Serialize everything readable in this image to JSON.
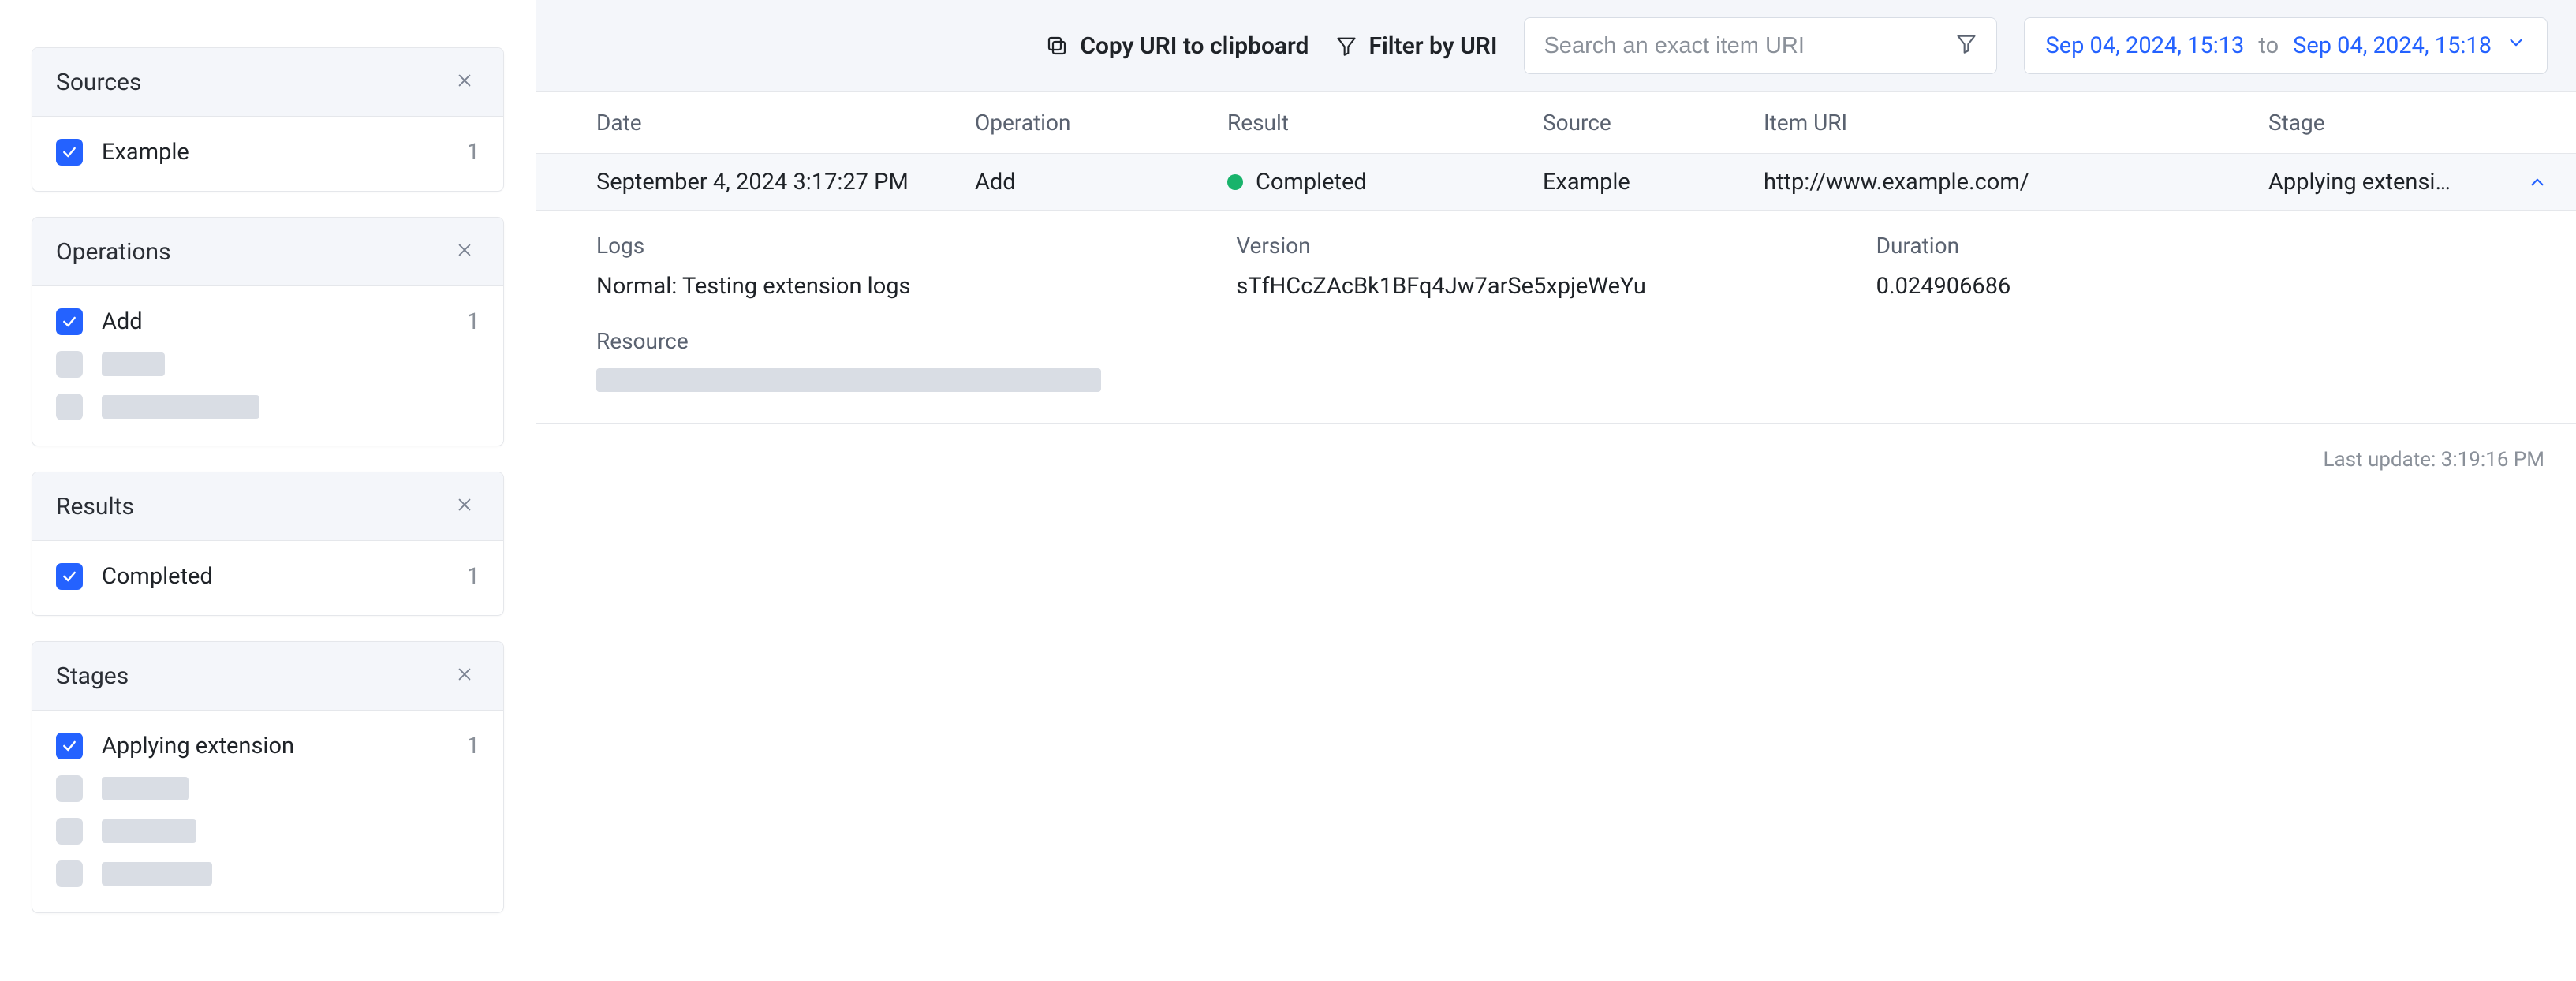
{
  "sidebar": {
    "filters": [
      {
        "key": "sources",
        "title": "Sources",
        "items": [
          {
            "label": "Example",
            "count": "1",
            "checked": true
          }
        ]
      },
      {
        "key": "operations",
        "title": "Operations",
        "items": [
          {
            "label": "Add",
            "count": "1",
            "checked": true
          }
        ],
        "skeletons": 2,
        "skeleton_widths": [
          80,
          200
        ]
      },
      {
        "key": "results",
        "title": "Results",
        "items": [
          {
            "label": "Completed",
            "count": "1",
            "checked": true
          }
        ]
      },
      {
        "key": "stages",
        "title": "Stages",
        "items": [
          {
            "label": "Applying extension",
            "count": "1",
            "checked": true
          }
        ],
        "skeletons": 3,
        "skeleton_widths": [
          110,
          120,
          140
        ]
      }
    ]
  },
  "toolbar": {
    "copy_uri_label": "Copy URI to clipboard",
    "filter_uri_label": "Filter by URI",
    "search_placeholder": "Search an exact item URI",
    "date_range": {
      "from": "Sep 04, 2024, 15:13",
      "sep": "to",
      "to": "Sep 04, 2024, 15:18"
    }
  },
  "table": {
    "columns": {
      "date": "Date",
      "operation": "Operation",
      "result": "Result",
      "source": "Source",
      "item_uri": "Item URI",
      "stage": "Stage"
    },
    "row": {
      "date": "September 4, 2024 3:17:27 PM",
      "operation": "Add",
      "result": "Completed",
      "source": "Example",
      "item_uri": "http://www.example.com/",
      "stage": "Applying extension",
      "status_color": "#18b36b"
    },
    "details": {
      "logs_label": "Logs",
      "version_label": "Version",
      "duration_label": "Duration",
      "logs_value": "Normal: Testing extension logs",
      "version_value": "sTfHCcZAcBk1BFq4Jw7arSe5xpjeWeYu",
      "duration_value": "0.024906686",
      "resource_label": "Resource"
    }
  },
  "footer": {
    "last_update_label": "Last update:",
    "last_update_value": "3:19:16 PM"
  }
}
